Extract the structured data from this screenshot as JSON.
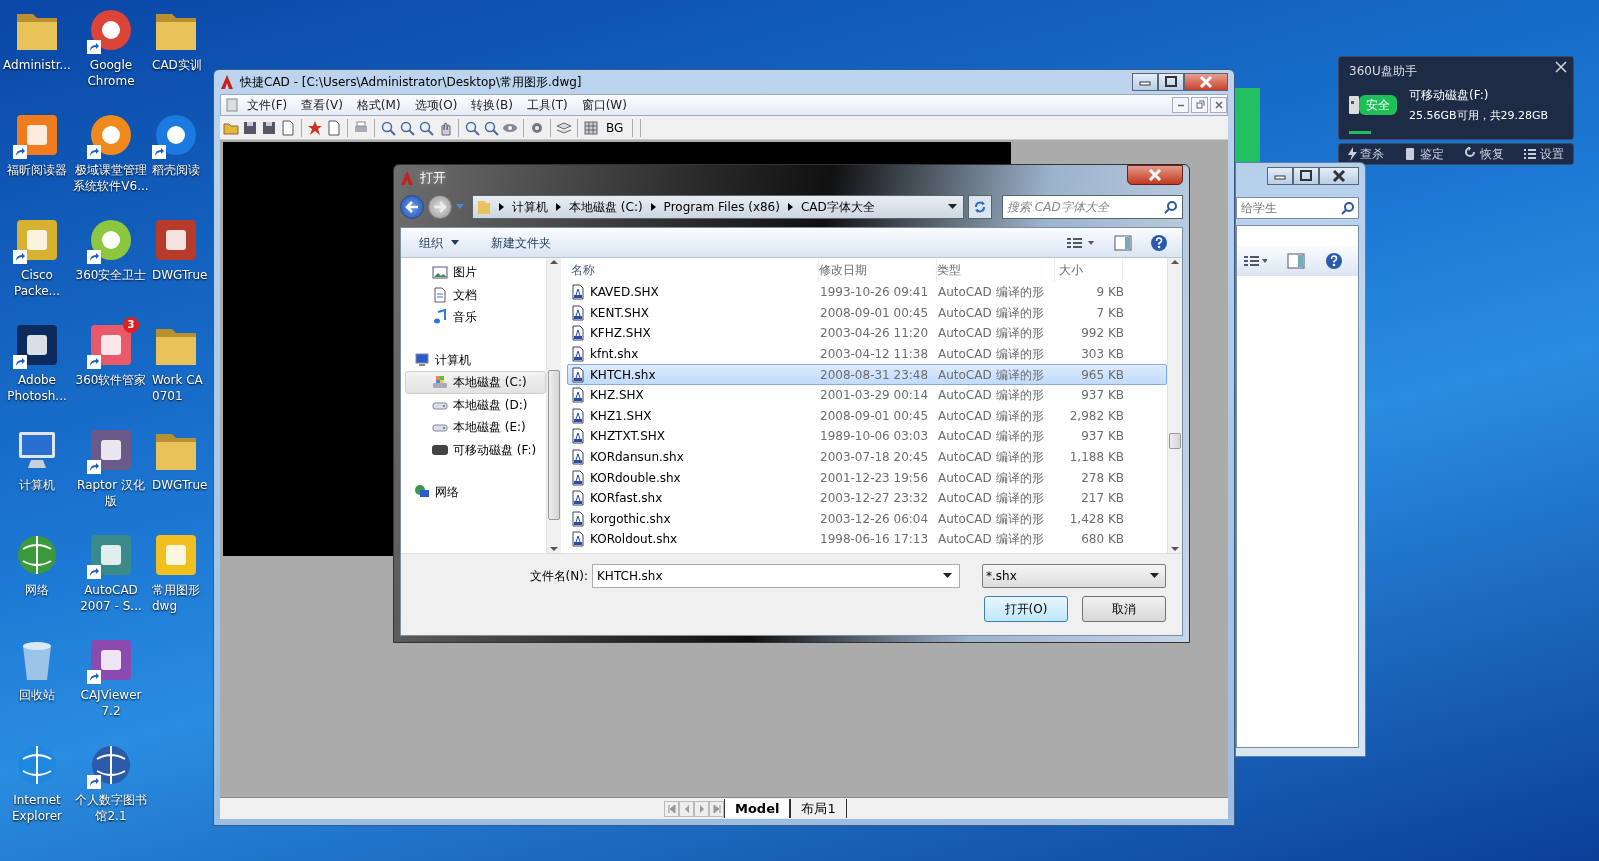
{
  "desktop_icons": [
    {
      "lines": [
        "Administr..."
      ],
      "kind": "folder",
      "color": "#e8c35a",
      "shortcut": false
    },
    {
      "lines": [
        "福昕阅读器"
      ],
      "kind": "app",
      "color": "#f07c1e",
      "shortcut": true
    },
    {
      "lines": [
        "Cisco",
        "Packe..."
      ],
      "kind": "app",
      "color": "#d9b130",
      "shortcut": true
    },
    {
      "lines": [
        "Adobe",
        "Photosh..."
      ],
      "kind": "app",
      "color": "#0d2a5c",
      "shortcut": true
    },
    {
      "lines": [
        "计算机"
      ],
      "kind": "computer",
      "color": "#2a6fd0",
      "shortcut": false
    },
    {
      "lines": [
        "网络"
      ],
      "kind": "globe",
      "color": "#3a9a3a",
      "shortcut": false
    },
    {
      "lines": [
        "回收站"
      ],
      "kind": "bin",
      "color": "#9cc4e8",
      "shortcut": false
    },
    {
      "lines": [
        "Internet",
        "Explorer"
      ],
      "kind": "globe",
      "color": "#1e88e0",
      "shortcut": false
    },
    {
      "lines": [
        "Google",
        "Chrome"
      ],
      "kind": "ring",
      "color": "#db4437",
      "shortcut": true
    },
    {
      "lines": [
        "极域课堂管理",
        "系统软件V6..."
      ],
      "kind": "ring",
      "color": "#f08a1c",
      "shortcut": true
    },
    {
      "lines": [
        "360安全卫士"
      ],
      "kind": "ring",
      "color": "#8dc63f",
      "shortcut": true
    },
    {
      "lines": [
        "360软件管家"
      ],
      "kind": "app",
      "color": "#e85a6a",
      "shortcut": true,
      "badge": "3"
    },
    {
      "lines": [
        "Raptor 汉化",
        "版"
      ],
      "kind": "app",
      "color": "#6a5a8a",
      "shortcut": true
    },
    {
      "lines": [
        "AutoCAD",
        "2007 - S..."
      ],
      "kind": "app",
      "color": "#3a8a8a",
      "shortcut": true
    },
    {
      "lines": [
        "CAJViewer",
        "7.2"
      ],
      "kind": "app",
      "color": "#8a4ab0",
      "shortcut": true
    },
    {
      "lines": [
        "个人数字图书",
        "馆2.1"
      ],
      "kind": "globe",
      "color": "#2a5aa8",
      "shortcut": true
    },
    {
      "lines": [
        "CAD实训"
      ],
      "kind": "folder",
      "color": "#e8c35a",
      "shortcut": false
    },
    {
      "lines": [
        "稻壳阅读"
      ],
      "kind": "ring",
      "color": "#1a7ae0",
      "shortcut": true
    },
    {
      "lines": [
        "DWGTrue"
      ],
      "kind": "app",
      "color": "#b83a2a",
      "shortcut": false
    },
    {
      "lines": [
        "Work CA",
        "0701"
      ],
      "kind": "folder",
      "color": "#e8c35a",
      "shortcut": false
    },
    {
      "lines": [
        "DWGTrue"
      ],
      "kind": "folder",
      "color": "#e8c35a",
      "shortcut": false
    },
    {
      "lines": [
        "常用图形",
        "dwg"
      ],
      "kind": "app",
      "color": "#f0c020",
      "shortcut": false
    }
  ],
  "back_window": {
    "search_placeholder": "给学生"
  },
  "u_disk_helper": {
    "title": "360U盘助手",
    "status": "安全",
    "drive": "可移动磁盘(F:)",
    "capacity": "25.56GB可用，共29.28GB",
    "actions": [
      "查杀",
      "鉴定",
      "恢复",
      "设置"
    ]
  },
  "cad_window": {
    "title": "快捷CAD - [C:\\Users\\Administrator\\Desktop\\常用图形.dwg]",
    "menu": [
      "文件(F)",
      "查看(V)",
      "格式(M)",
      "选项(O)",
      "转换(B)",
      "工具(T)",
      "窗口(W)"
    ],
    "toolbar_text": "BG",
    "tabs": [
      {
        "label": "Model",
        "selected": true
      },
      {
        "label": "布局1",
        "selected": false
      }
    ]
  },
  "open_dialog": {
    "title": "打开",
    "breadcrumb": [
      "计算机",
      "本地磁盘 (C:)",
      "Program Files (x86)",
      "CAD字体大全"
    ],
    "search_placeholder": "搜索 CAD字体大全",
    "toolbar": [
      "组织",
      "新建文件夹"
    ],
    "nav": [
      {
        "children": [
          {
            "label": "图片",
            "kind": "pictures",
            "selected": false
          },
          {
            "label": "文档",
            "kind": "documents",
            "selected": false
          },
          {
            "label": "音乐",
            "kind": "music",
            "selected": false
          }
        ]
      },
      {
        "label": "计算机",
        "kind": "computer",
        "selected": false,
        "children": [
          {
            "label": "本地磁盘 (C:)",
            "kind": "system_disk",
            "selected": true
          },
          {
            "label": "本地磁盘 (D:)",
            "kind": "disk",
            "selected": false
          },
          {
            "label": "本地磁盘 (E:)",
            "kind": "disk",
            "selected": false
          },
          {
            "label": "可移动磁盘 (F:)",
            "kind": "removable",
            "selected": false
          }
        ]
      },
      {
        "label": "网络",
        "kind": "network",
        "selected": false
      }
    ],
    "columns": [
      "名称",
      "修改日期",
      "类型",
      "大小"
    ],
    "rows": [
      {
        "name": "KAVED.SHX",
        "date": "1993-10-26 09:41",
        "type": "AutoCAD 编译的形",
        "size": "9 KB",
        "selected": false
      },
      {
        "name": "KENT.SHX",
        "date": "2008-09-01 00:45",
        "type": "AutoCAD 编译的形",
        "size": "7 KB",
        "selected": false
      },
      {
        "name": "KFHZ.SHX",
        "date": "2003-04-26 11:20",
        "type": "AutoCAD 编译的形",
        "size": "992 KB",
        "selected": false
      },
      {
        "name": "kfnt.shx",
        "date": "2003-04-12 11:38",
        "type": "AutoCAD 编译的形",
        "size": "303 KB",
        "selected": false
      },
      {
        "name": "KHTCH.shx",
        "date": "2008-08-31 23:48",
        "type": "AutoCAD 编译的形",
        "size": "965 KB",
        "selected": true
      },
      {
        "name": "KHZ.SHX",
        "date": "2001-03-29 00:14",
        "type": "AutoCAD 编译的形",
        "size": "937 KB",
        "selected": false
      },
      {
        "name": "KHZ1.SHX",
        "date": "2008-09-01 00:45",
        "type": "AutoCAD 编译的形",
        "size": "2,982 KB",
        "selected": false
      },
      {
        "name": "KHZTXT.SHX",
        "date": "1989-10-06 03:03",
        "type": "AutoCAD 编译的形",
        "size": "937 KB",
        "selected": false
      },
      {
        "name": "KORdansun.shx",
        "date": "2003-07-18 20:45",
        "type": "AutoCAD 编译的形",
        "size": "1,188 KB",
        "selected": false
      },
      {
        "name": "KORdouble.shx",
        "date": "2001-12-23 19:56",
        "type": "AutoCAD 编译的形",
        "size": "278 KB",
        "selected": false
      },
      {
        "name": "KORfast.shx",
        "date": "2003-12-27 23:32",
        "type": "AutoCAD 编译的形",
        "size": "217 KB",
        "selected": false
      },
      {
        "name": "korgothic.shx",
        "date": "2003-12-26 06:04",
        "type": "AutoCAD 编译的形",
        "size": "1,428 KB",
        "selected": false
      },
      {
        "name": "KORoldout.shx",
        "date": "1998-06-16 17:13",
        "type": "AutoCAD 编译的形",
        "size": "680 KB",
        "selected": false
      }
    ],
    "filename_label": "文件名(N):",
    "filename": "KHTCH.shx",
    "filter": "*.shx",
    "buttons": [
      "打开(O)",
      "取消"
    ]
  }
}
